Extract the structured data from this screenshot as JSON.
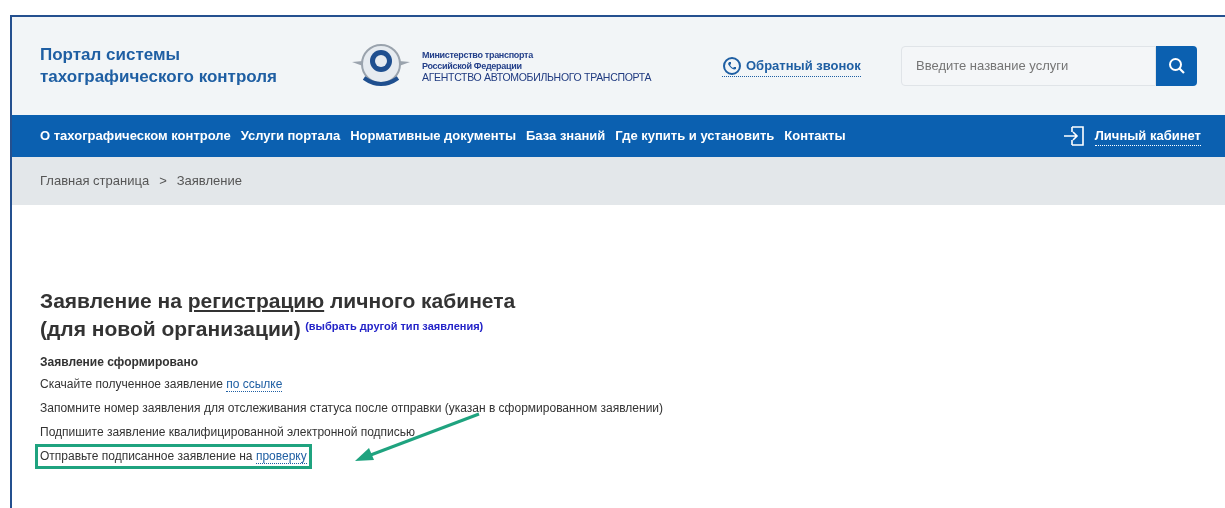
{
  "header": {
    "portal_title": [
      "Портал системы",
      "тахографического контроля"
    ],
    "agency_lines": [
      "Министерство транспорта",
      "Российской Федерации",
      "АГЕНТСТВО АВТОМОБИЛЬНОГО ТРАНСПОРТА"
    ],
    "callback_link": "Обратный звонок",
    "search": {
      "placeholder": "Введите название услуги"
    }
  },
  "nav": {
    "items": [
      "О тахографическом контроле",
      "Услуги портала",
      "Нормативные документы",
      "База знаний",
      "Где купить и установить",
      "Контакты"
    ],
    "account_link": "Личный кабинет"
  },
  "breadcrumb": [
    "Главная страница",
    "Заявление"
  ],
  "breadcrumb_separator": ">",
  "page": {
    "title_parts": [
      {
        "text": "Заявление на ",
        "kind": "plain"
      },
      {
        "text": "регистрацию",
        "kind": "underlined"
      },
      {
        "text": " личного кабинета",
        "kind": "plain"
      }
    ],
    "title_line2": "(для новой организации)",
    "change_type_link": "(выбрать другой тип заявления)",
    "status_heading": "Заявление сформировано",
    "steps": [
      {
        "text": "Скачайте полученное заявление ",
        "link": "по ссылке",
        "highlighted": false
      },
      {
        "text": "Запомните номер заявления для отслеживания статуса после отправки (указан в сформированном заявлении)",
        "highlighted": false
      },
      {
        "text": "Подпишите заявление квалифицированной электронной подписью",
        "highlighted": false
      },
      {
        "text": "Отправьте подписанное заявление на ",
        "link": "проверку",
        "highlighted": true
      }
    ]
  }
}
